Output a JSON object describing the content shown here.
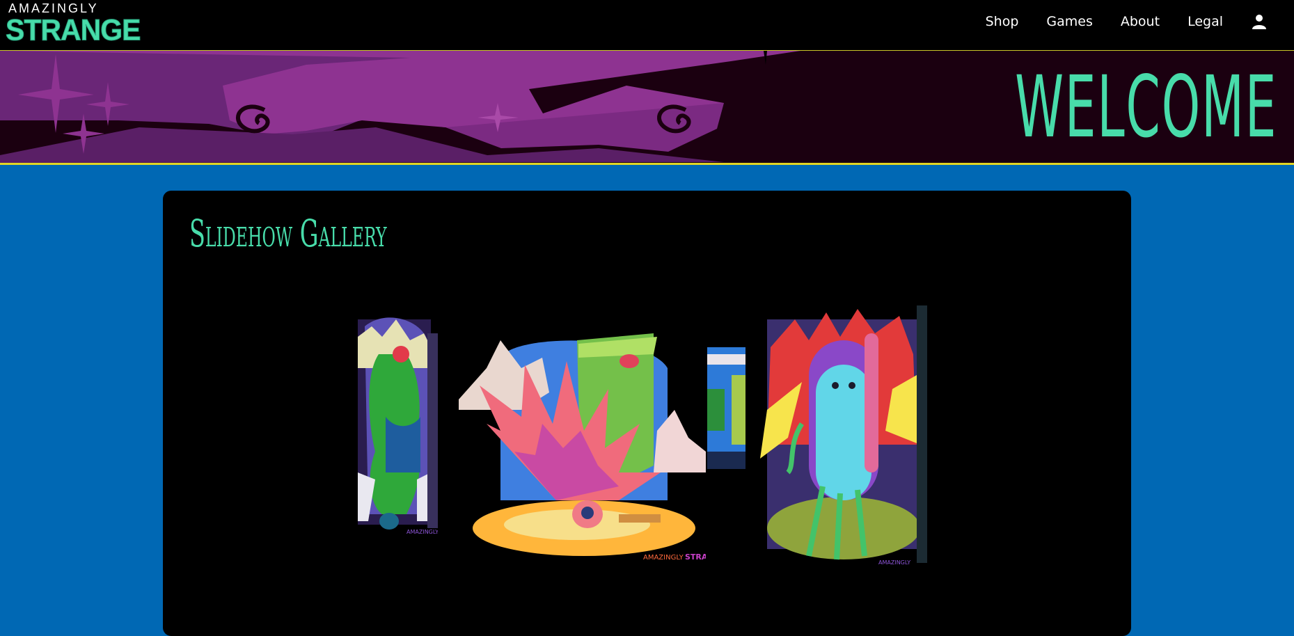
{
  "brand": {
    "top": "AMAZINGLY",
    "main": "STRANGE"
  },
  "nav": {
    "shop": "Shop",
    "games": "Games",
    "about": "About",
    "legal": "Legal",
    "user_icon": "user-icon"
  },
  "banner": {
    "heading": "WELCOME"
  },
  "gallery": {
    "title": "Slidehow Gallery",
    "slides": [
      {
        "id": "green-bird-creature"
      },
      {
        "id": "spiky-fan-creature"
      },
      {
        "id": "capsule-creature"
      }
    ]
  },
  "colors": {
    "accent": "#48dcaa",
    "page_bg": "#0068b4",
    "banner_border": "#e1d524",
    "banner_purple": "#8e3391"
  }
}
